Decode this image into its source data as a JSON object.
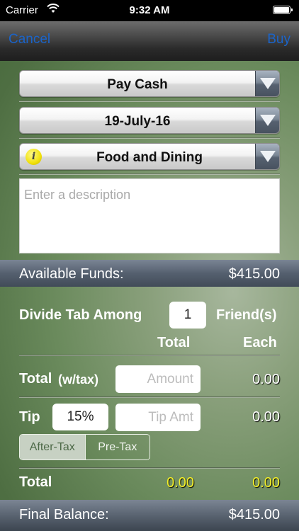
{
  "status_bar": {
    "carrier": "Carrier",
    "time": "9:32 AM"
  },
  "nav": {
    "cancel_label": "Cancel",
    "buy_label": "Buy",
    "accent": "#1b64c9"
  },
  "payment_method": {
    "value": "Pay Cash"
  },
  "date": {
    "value": "19-July-16"
  },
  "category": {
    "value": "Food and Dining",
    "icon": "info-icon"
  },
  "description": {
    "placeholder": "Enter a description",
    "value": ""
  },
  "available_funds": {
    "label": "Available Funds:",
    "amount": "$415.00"
  },
  "divide": {
    "label": "Divide Tab Among",
    "count": "1",
    "suffix": "Friend(s)"
  },
  "columns": {
    "total": "Total",
    "each": "Each"
  },
  "total_row": {
    "label": "Total",
    "sublabel": "(w/tax)",
    "placeholder": "Amount",
    "each": "0.00"
  },
  "tip_row": {
    "label": "Tip",
    "percent": "15%",
    "placeholder": "Tip Amt",
    "each": "0.00"
  },
  "tip_mode": {
    "options": [
      "After-Tax",
      "Pre-Tax"
    ],
    "selected": "After-Tax"
  },
  "grand_total": {
    "label": "Total",
    "total": "0.00",
    "each": "0.00"
  },
  "final_balance": {
    "label": "Final Balance:",
    "amount": "$415.00"
  }
}
